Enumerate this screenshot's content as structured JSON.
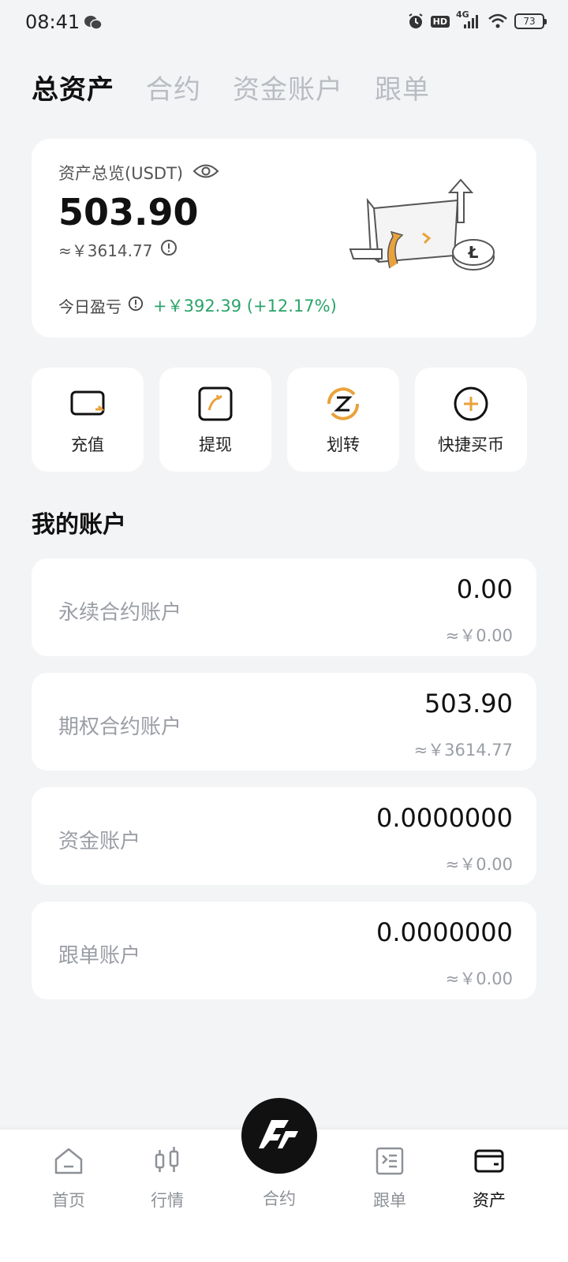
{
  "status_bar": {
    "time": "08:41",
    "hd": "HD",
    "network": "4G",
    "battery": "73"
  },
  "tabs": [
    {
      "label": "总资产",
      "active": true
    },
    {
      "label": "合约",
      "active": false
    },
    {
      "label": "资金账户",
      "active": false
    },
    {
      "label": "跟单",
      "active": false
    }
  ],
  "overview": {
    "label": "资产总览(USDT)",
    "total": "503.90",
    "cny_value": "≈￥3614.77",
    "pnl_label": "今日盈亏",
    "pnl_value": "+￥392.39 (+12.17%)"
  },
  "actions": [
    {
      "label": "充值",
      "icon": "deposit-icon"
    },
    {
      "label": "提现",
      "icon": "withdraw-icon"
    },
    {
      "label": "划转",
      "icon": "transfer-icon"
    },
    {
      "label": "快捷买币",
      "icon": "quick-buy-icon"
    }
  ],
  "accounts_section": {
    "title": "我的账户"
  },
  "accounts": [
    {
      "name": "永续合约账户",
      "amount": "0.00",
      "cny": "≈￥0.00"
    },
    {
      "name": "期权合约账户",
      "amount": "503.90",
      "cny": "≈￥3614.77"
    },
    {
      "name": "资金账户",
      "amount": "0.0000000",
      "cny": "≈￥0.00"
    },
    {
      "name": "跟单账户",
      "amount": "0.0000000",
      "cny": "≈￥0.00"
    }
  ],
  "bottom_nav": [
    {
      "label": "首页",
      "icon": "home-icon",
      "active": false
    },
    {
      "label": "行情",
      "icon": "market-icon",
      "active": false
    },
    {
      "label": "合约",
      "icon": "contract-logo-icon",
      "active": false
    },
    {
      "label": "跟单",
      "icon": "copy-trade-icon",
      "active": false
    },
    {
      "label": "资产",
      "icon": "wallet-icon",
      "active": true
    }
  ],
  "colors": {
    "accent": "#e9a23b",
    "profit_green": "#2ba36a",
    "background": "#f3f4f6"
  }
}
